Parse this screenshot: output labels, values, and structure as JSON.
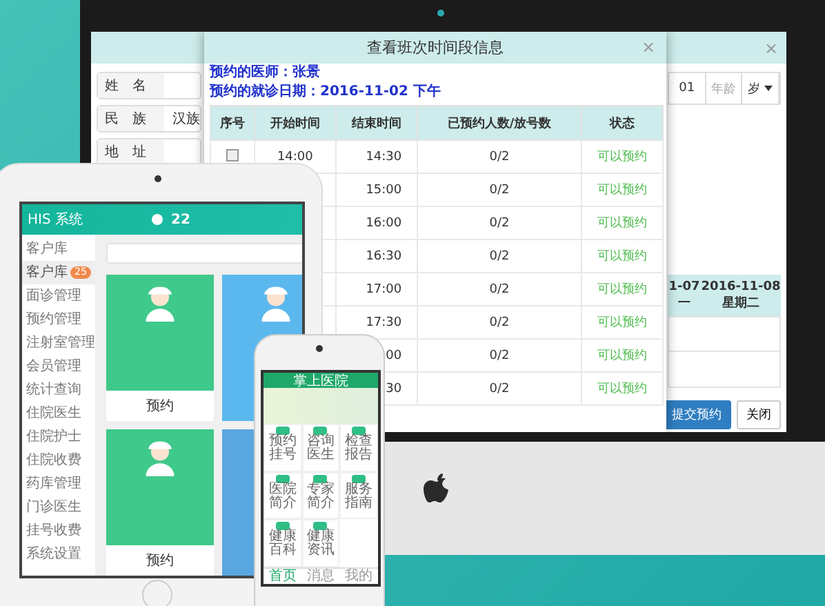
{
  "monitor": {
    "form": {
      "fields": [
        {
          "label": "姓　名"
        },
        {
          "label": "民　族",
          "value": "汉族"
        },
        {
          "label": "地　址"
        }
      ],
      "close": "×",
      "birth_tail": "01",
      "age_label": "年龄",
      "age_unit": "岁",
      "schedule_columns": [
        {
          "date": "1-07",
          "weekday": "一"
        },
        {
          "date": "2016-11-08",
          "weekday": "星期二"
        }
      ],
      "buttons": [
        {
          "label": "提交预约",
          "kind": "primary"
        },
        {
          "label": "关闭",
          "kind": "plain"
        }
      ]
    },
    "modal": {
      "title": "查看班次时间段信息",
      "close": "×",
      "doctor": "预约的医师：张景",
      "date": "预约的就诊日期：2016-11-02 下午",
      "columns": [
        "序号",
        "开始时间",
        "结束时间",
        "已预约人数/放号数",
        "状态"
      ],
      "rows": [
        {
          "checked": false,
          "start": "14:00",
          "end": "14:30",
          "count": "0/2",
          "status": "可以预约"
        },
        {
          "end": "15:00",
          "count": "0/2",
          "status": "可以预约"
        },
        {
          "end": "16:00",
          "count": "0/2",
          "status": "可以预约"
        },
        {
          "end": "16:30",
          "count": "0/2",
          "status": "可以预约"
        },
        {
          "end": "17:00",
          "count": "0/2",
          "status": "可以预约"
        },
        {
          "end": "17:30",
          "count": "0/2",
          "status": "可以预约"
        },
        {
          "end": "00",
          "count": "0/2",
          "status": "可以预约"
        },
        {
          "end": "30",
          "count": "0/2",
          "status": "可以预约"
        }
      ]
    }
  },
  "tablet": {
    "app_name": "HIS 系统",
    "temperature": "22",
    "sidebar": [
      {
        "label": "客户库",
        "selected": false
      },
      {
        "label": "客户库",
        "selected": true,
        "badge": "25"
      },
      {
        "label": "面诊管理",
        "selected": false
      },
      {
        "label": "预约管理",
        "selected": false
      },
      {
        "label": "注射室管理",
        "selected": false
      },
      {
        "label": "会员管理",
        "selected": false
      },
      {
        "label": "统计查询",
        "selected": false
      },
      {
        "label": "住院医生",
        "selected": false
      },
      {
        "label": "住院护士",
        "selected": false
      },
      {
        "label": "住院收费",
        "selected": false
      },
      {
        "label": "药库管理",
        "selected": false
      },
      {
        "label": "门诊医生",
        "selected": false
      },
      {
        "label": "挂号收费",
        "selected": false
      },
      {
        "label": "系统设置",
        "selected": false
      }
    ],
    "cards": [
      {
        "color": "#3fc98a",
        "action": "预约"
      },
      {
        "color": "#5bb8ee"
      },
      {
        "color": "#3fc98a",
        "action": "预约"
      },
      {
        "color": "#5aa6e0"
      }
    ]
  },
  "phone": {
    "title": "掌上医院",
    "grid": [
      "预约挂号",
      "咨询医生",
      "检查报告",
      "医院简介",
      "专家简介",
      "服务指南",
      "健康百科",
      "健康资讯"
    ],
    "tabs": [
      {
        "label": "首页",
        "selected": true
      },
      {
        "label": "消息",
        "selected": false
      },
      {
        "label": "我的",
        "selected": false
      }
    ]
  }
}
